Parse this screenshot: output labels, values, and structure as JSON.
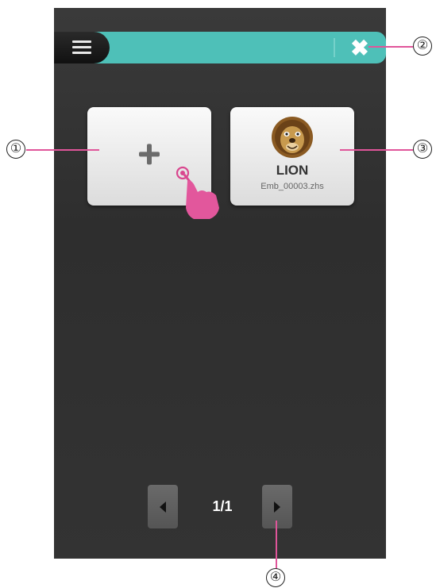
{
  "topbar": {
    "menu_icon": "hamburger-icon",
    "close_icon": "close-x-icon",
    "accent_color": "#4ec0b8"
  },
  "tiles": [
    {
      "type": "add",
      "icon": "plus-icon"
    },
    {
      "type": "file",
      "icon": "lion-embroidery-icon",
      "title": "LION",
      "filename": "Emb_00003.zhs"
    }
  ],
  "pager": {
    "page_label": "1/1",
    "prev_icon": "chevron-left-icon",
    "next_icon": "chevron-right-icon"
  },
  "callouts": [
    "①",
    "②",
    "③",
    "④"
  ],
  "hand_icon": "tap-hand-icon",
  "colors": {
    "callout_line": "#e0559a",
    "background": "#333333"
  }
}
